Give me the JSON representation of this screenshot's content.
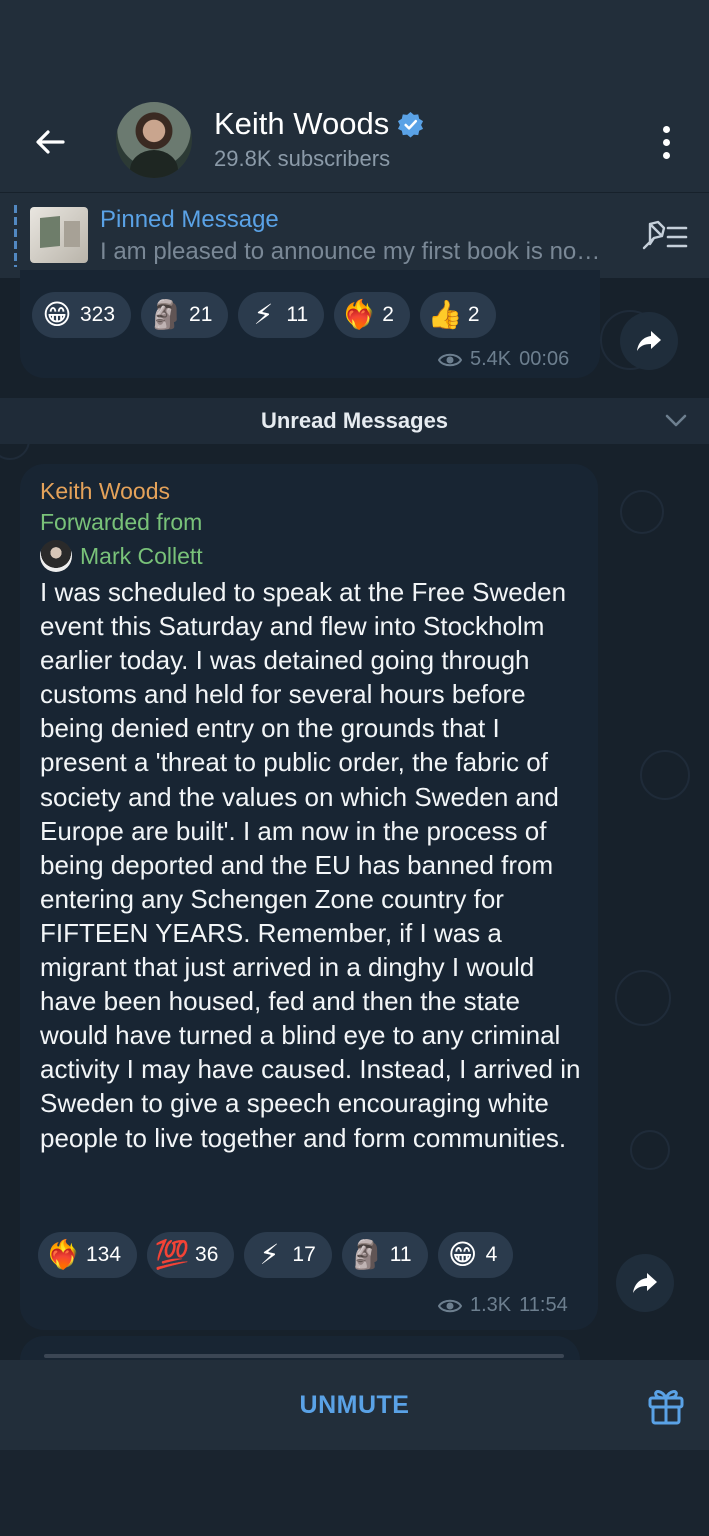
{
  "header": {
    "channel_name": "Keith Woods",
    "subscribers": "29.8K subscribers"
  },
  "pinned": {
    "title": "Pinned Message",
    "text": "I am pleased to announce my first book is no…"
  },
  "top_message": {
    "reactions": [
      {
        "emoji": "😁",
        "count": "323"
      },
      {
        "emoji": "🗿",
        "count": "21"
      },
      {
        "emoji": "⚡",
        "count": "11"
      },
      {
        "emoji": "❤️‍🔥",
        "count": "2"
      },
      {
        "emoji": "👍",
        "count": "2"
      }
    ],
    "views": "5.4K",
    "time": "00:06"
  },
  "unread_label": "Unread Messages",
  "main_message": {
    "author": "Keith Woods",
    "forwarded_label": "Forwarded from",
    "forwarded_from": "Mark Collett",
    "text": "I was scheduled to speak at the Free Sweden event this Saturday and flew into Stockholm earlier today. I was detained going through customs and held for several hours before being denied entry on the grounds that I present a 'threat to public order, the fabric of society and the values on which Sweden and Europe are built'. I am now in the process of being deported and the EU has banned from entering any Schengen Zone country for FIFTEEN YEARS. Remember, if I was a migrant that just arrived in a dinghy I would have been housed, fed and then the state would have turned a blind eye to any criminal activity I may have caused. Instead, I arrived in Sweden to give a speech encouraging white people to live together and form communities.",
    "reactions": [
      {
        "emoji": "❤️‍🔥",
        "count": "134"
      },
      {
        "emoji": "💯",
        "count": "36"
      },
      {
        "emoji": "⚡",
        "count": "17"
      },
      {
        "emoji": "🗿",
        "count": "11"
      },
      {
        "emoji": "😁",
        "count": "4"
      }
    ],
    "views": "1.3K",
    "time": "11:54"
  },
  "bottom_bar": {
    "unmute_label": "UNMUTE"
  },
  "colors": {
    "accent": "#5aa2e6",
    "author": "#e4a25a",
    "forward": "#79c279",
    "background": "#0e1621",
    "bubble": "#182533"
  }
}
